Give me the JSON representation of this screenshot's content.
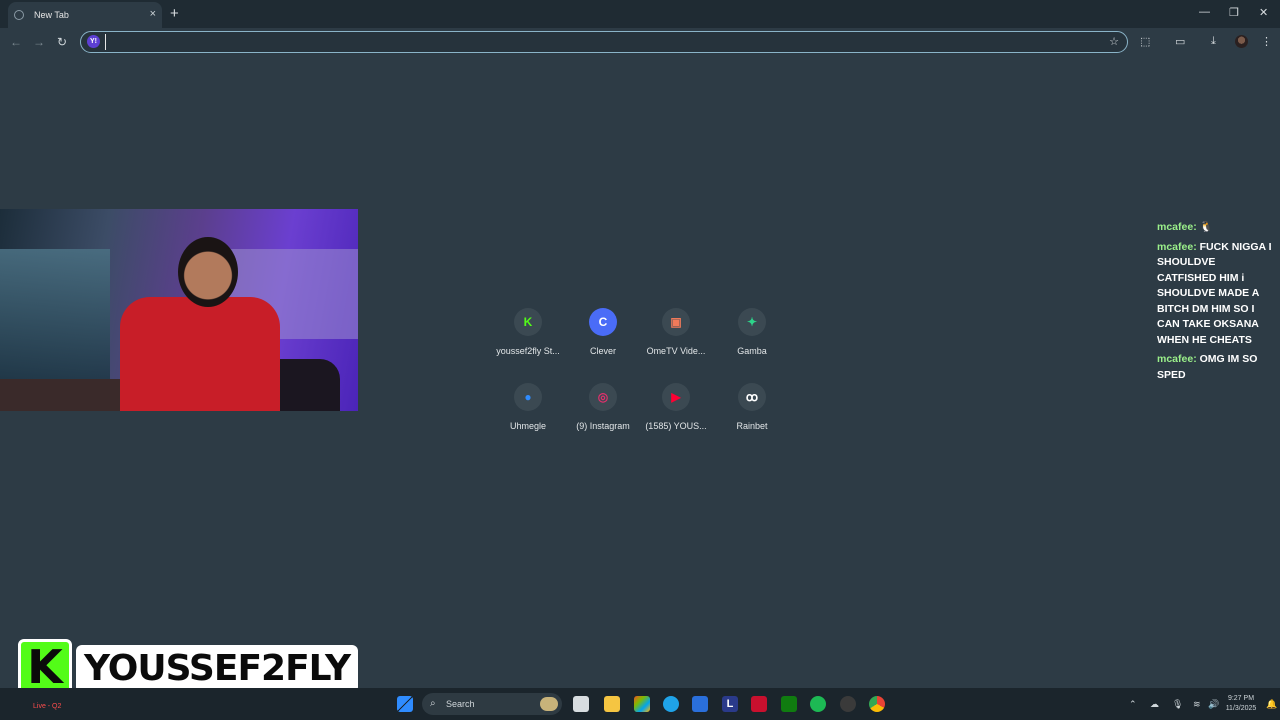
{
  "browser": {
    "tab_title": "New Tab",
    "new_tab_symbol": "+",
    "close_symbol": "×",
    "omnibox_value": "",
    "omnibox_engine_icon": "Y!"
  },
  "shortcuts": [
    {
      "label": "youssef2fly St...",
      "icon": "kick-icon",
      "glyph": "K",
      "color": "#53fc18"
    },
    {
      "label": "Clever",
      "icon": "clever-icon",
      "glyph": "C",
      "color": "#4a6cf7"
    },
    {
      "label": "OmeTV Vide...",
      "icon": "ometv-icon",
      "glyph": "▣",
      "color": "#f07a5a"
    },
    {
      "label": "Gamba",
      "icon": "gamba-icon",
      "glyph": "✦",
      "color": "#2dd48a"
    },
    {
      "label": "Uhmegle",
      "icon": "uhmegle-icon",
      "glyph": "●",
      "color": "#2f8cff"
    },
    {
      "label": "(9) Instagram",
      "icon": "instagram-icon",
      "glyph": "◎",
      "color": "#e1306c"
    },
    {
      "label": "(1585) YOUS...",
      "icon": "youtube-icon",
      "glyph": "▶",
      "color": "#ff0033"
    },
    {
      "label": "Rainbet",
      "icon": "rainbet-icon",
      "glyph": "ꝏ",
      "color": "#ffffff"
    }
  ],
  "chat": [
    {
      "user": "mcafee:",
      "text": "🐧"
    },
    {
      "user": "mcafee:",
      "text": "FUCK NIGGA I SHOULDVE CATFISHED HIM i SHOULDVE MADE A BITCH DM HIM SO I CAN TAKE OKSANA WHEN HE CHEATS"
    },
    {
      "user": "mcafee:",
      "text": "OMG IM SO SPED"
    }
  ],
  "overlay": {
    "logo_letter": "K",
    "streamer_name": "YOUSSEF2FLY",
    "brand_color": "#53fc18"
  },
  "taskbar": {
    "weather_text": "Live - Q2",
    "search_label": "Search",
    "time": "9:27 PM",
    "date": "11/3/2025"
  }
}
